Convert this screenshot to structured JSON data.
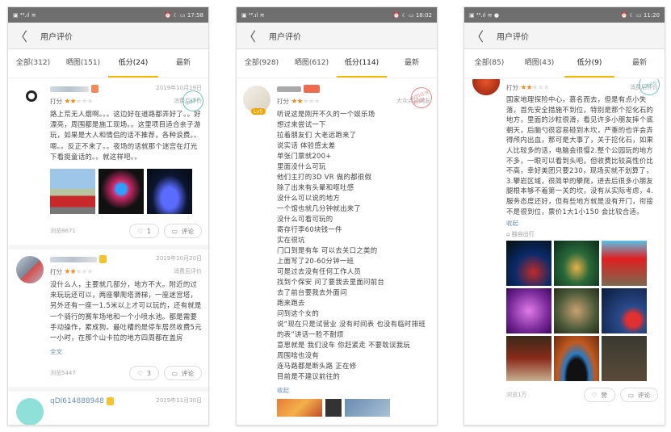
{
  "screens": [
    {
      "status_time": "17:58",
      "title": "用户评价",
      "tabs": [
        "全部(312)",
        "晒图(151)",
        "低分(24)",
        "最新"
      ],
      "reviews": [
        {
          "date": "2019年10月19日",
          "score_label": "打分",
          "stars": 2,
          "source": "消费后评价",
          "stamp": "认真评价",
          "text": "路上荒无人烟啊。。。这边好在道路都弄好了。。好漂亮，周围都是施工现场。。这里项目适合亲子游玩，如果是大人和情侣的话不推荐，各种浪费。。嗯。。反正不来了。。夜场的话就那个迷宫在灯光下看挺童话的。。就这样吧。。",
          "views": "浏览8671",
          "likes": "1",
          "comment": "评论"
        },
        {
          "date": "2019年10月20日",
          "score_label": "打分",
          "stars": 2,
          "source": "消费后评价",
          "text": "没什么人，主要就几部分，地方不大。附近的过来玩玩还可以，两座攀爬塔滑梯，一座迷宫塔，另外还有一座一1.5米以上才可以玩的，还有就是一个骑行的赛车场地和一个小喷水池。都是需要手动操作，累成狗。最吐槽的是停车居然收费5元一小时，在那个山卡拉的地方四周都在盖房",
          "more": "全文",
          "views": "浏览5447",
          "likes": "3",
          "comment": "评论"
        },
        {
          "name": "qDI614888948",
          "date": "2019年11月30日"
        }
      ]
    },
    {
      "status_time": "18:02",
      "title": "用户评价",
      "tabs": [
        "全部(928)",
        "晒图(612)",
        "低分(114)",
        "最新"
      ],
      "review": {
        "level": "Lv5",
        "score_label": "打分",
        "stars": 2,
        "source": "大众点评网友",
        "stamp": "5月5日 优质点评",
        "lines": [
          "听说这是刚开不久的一个娱乐场",
          "想过来尝试一下",
          "拉着朋友们 大老远跑来了",
          "说实话 体验感太差",
          "单张门票就200+",
          "里面没什么可玩",
          "他们主打的3D VR 做的都很假",
          "除了出来有头晕和呕吐感",
          "没什么可以说的地方",
          "一个馆也就几分钟就出来了",
          "没什么可看可玩的",
          "寄存行李60块钱一件",
          "实在很坑",
          "门口到是有车 可以去关口之类的",
          "上面写了20-60分钟一班",
          "可是过去没有任何工作人员",
          "找到个保安 问了要我去里面问前台",
          "去了前台要我去外面问",
          "跑来跑去",
          "问到这个女的",
          "说“现在只是试营业 没有时间表 也没有临时排班的表”讲话一脸不耐烦",
          "意思就是 我们没车 你赶紧走 不要耽误我玩",
          "周围啥也没有",
          "连马路都是断头路 正在修",
          "目前是不建议前往的"
        ],
        "collapse": "收起"
      }
    },
    {
      "status_time": "11:20",
      "title": "用户评价",
      "tabs": [
        "全部(85)",
        "晒图(43)",
        "低分(9)",
        "最新"
      ],
      "review": {
        "score_label": "打分",
        "stars": 2,
        "source": "消费后评价",
        "stamp": "认真评价",
        "text": "国家地理探险中心，慕名而去，但是有点小失落，首先安全措施不到位，特别是那个挖化石的地方，里面的沙粒很滑，看见许多小朋友摔个底朝天，后脑勺很容易碰到木坎，严重的也许会弄得颅内出血，那可是大事了，关于挖化石，如果人比较多的话，电脑会很慢2.整个公园玩的地方不多，一眼可以看到头吧，但收费比较高性价比不高，幸好美团只要230，现场买就不划算了，3.攀岩区域，很简单的攀爬，进去后很多小朋友腿根本够不着第一关的坎，没有从实际考虑，4.服务态度还好，但有些地方就是没有开门，衔接不是很到位，票价1大1小150 会比较合适。",
        "collapse": "收起",
        "tag": "独自出行",
        "views": "浏览1万",
        "like": "赞",
        "comment": "评论"
      }
    }
  ],
  "colors": {
    "accent": "#f5b800",
    "star": "#f58a1f",
    "link": "#6b8fb8"
  }
}
